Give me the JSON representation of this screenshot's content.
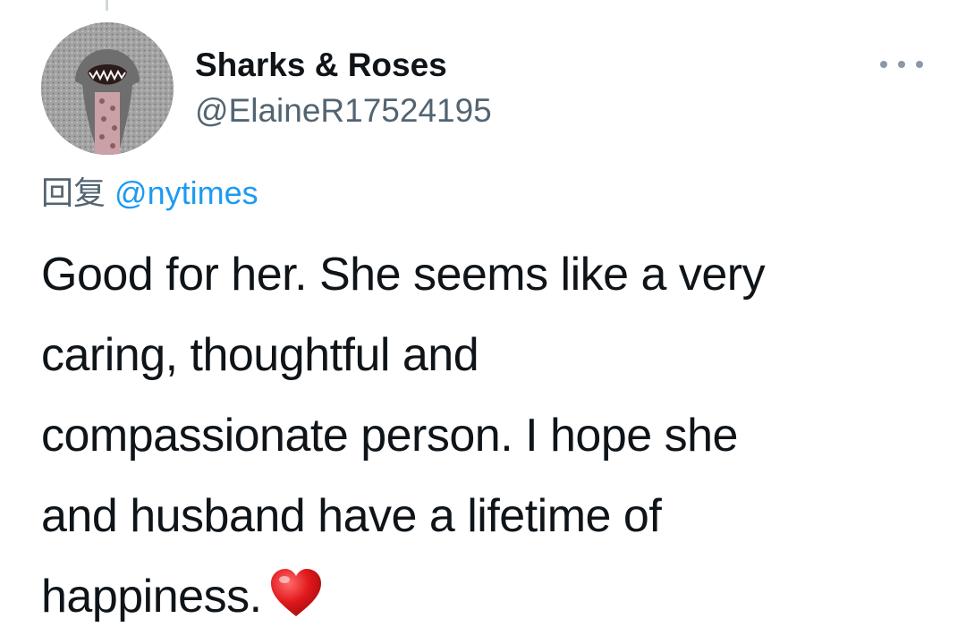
{
  "tweet": {
    "author": {
      "display_name": "Sharks & Roses",
      "handle": "@ElaineR17524195",
      "avatar_icon": "shark-avatar-icon"
    },
    "more_icon": "more-options-icon",
    "reply": {
      "prefix": "回复",
      "mention": "@nytimes"
    },
    "text_lines": [
      "Good for her. She seems like a very",
      "caring, thoughtful and",
      "compassionate person. I hope she",
      "and husband have a lifetime of",
      "happiness."
    ],
    "emoji": "red-heart-icon",
    "colors": {
      "text": "#0f1419",
      "secondary": "#536471",
      "link": "#1d9bf0",
      "heart": "#e0181b"
    }
  }
}
